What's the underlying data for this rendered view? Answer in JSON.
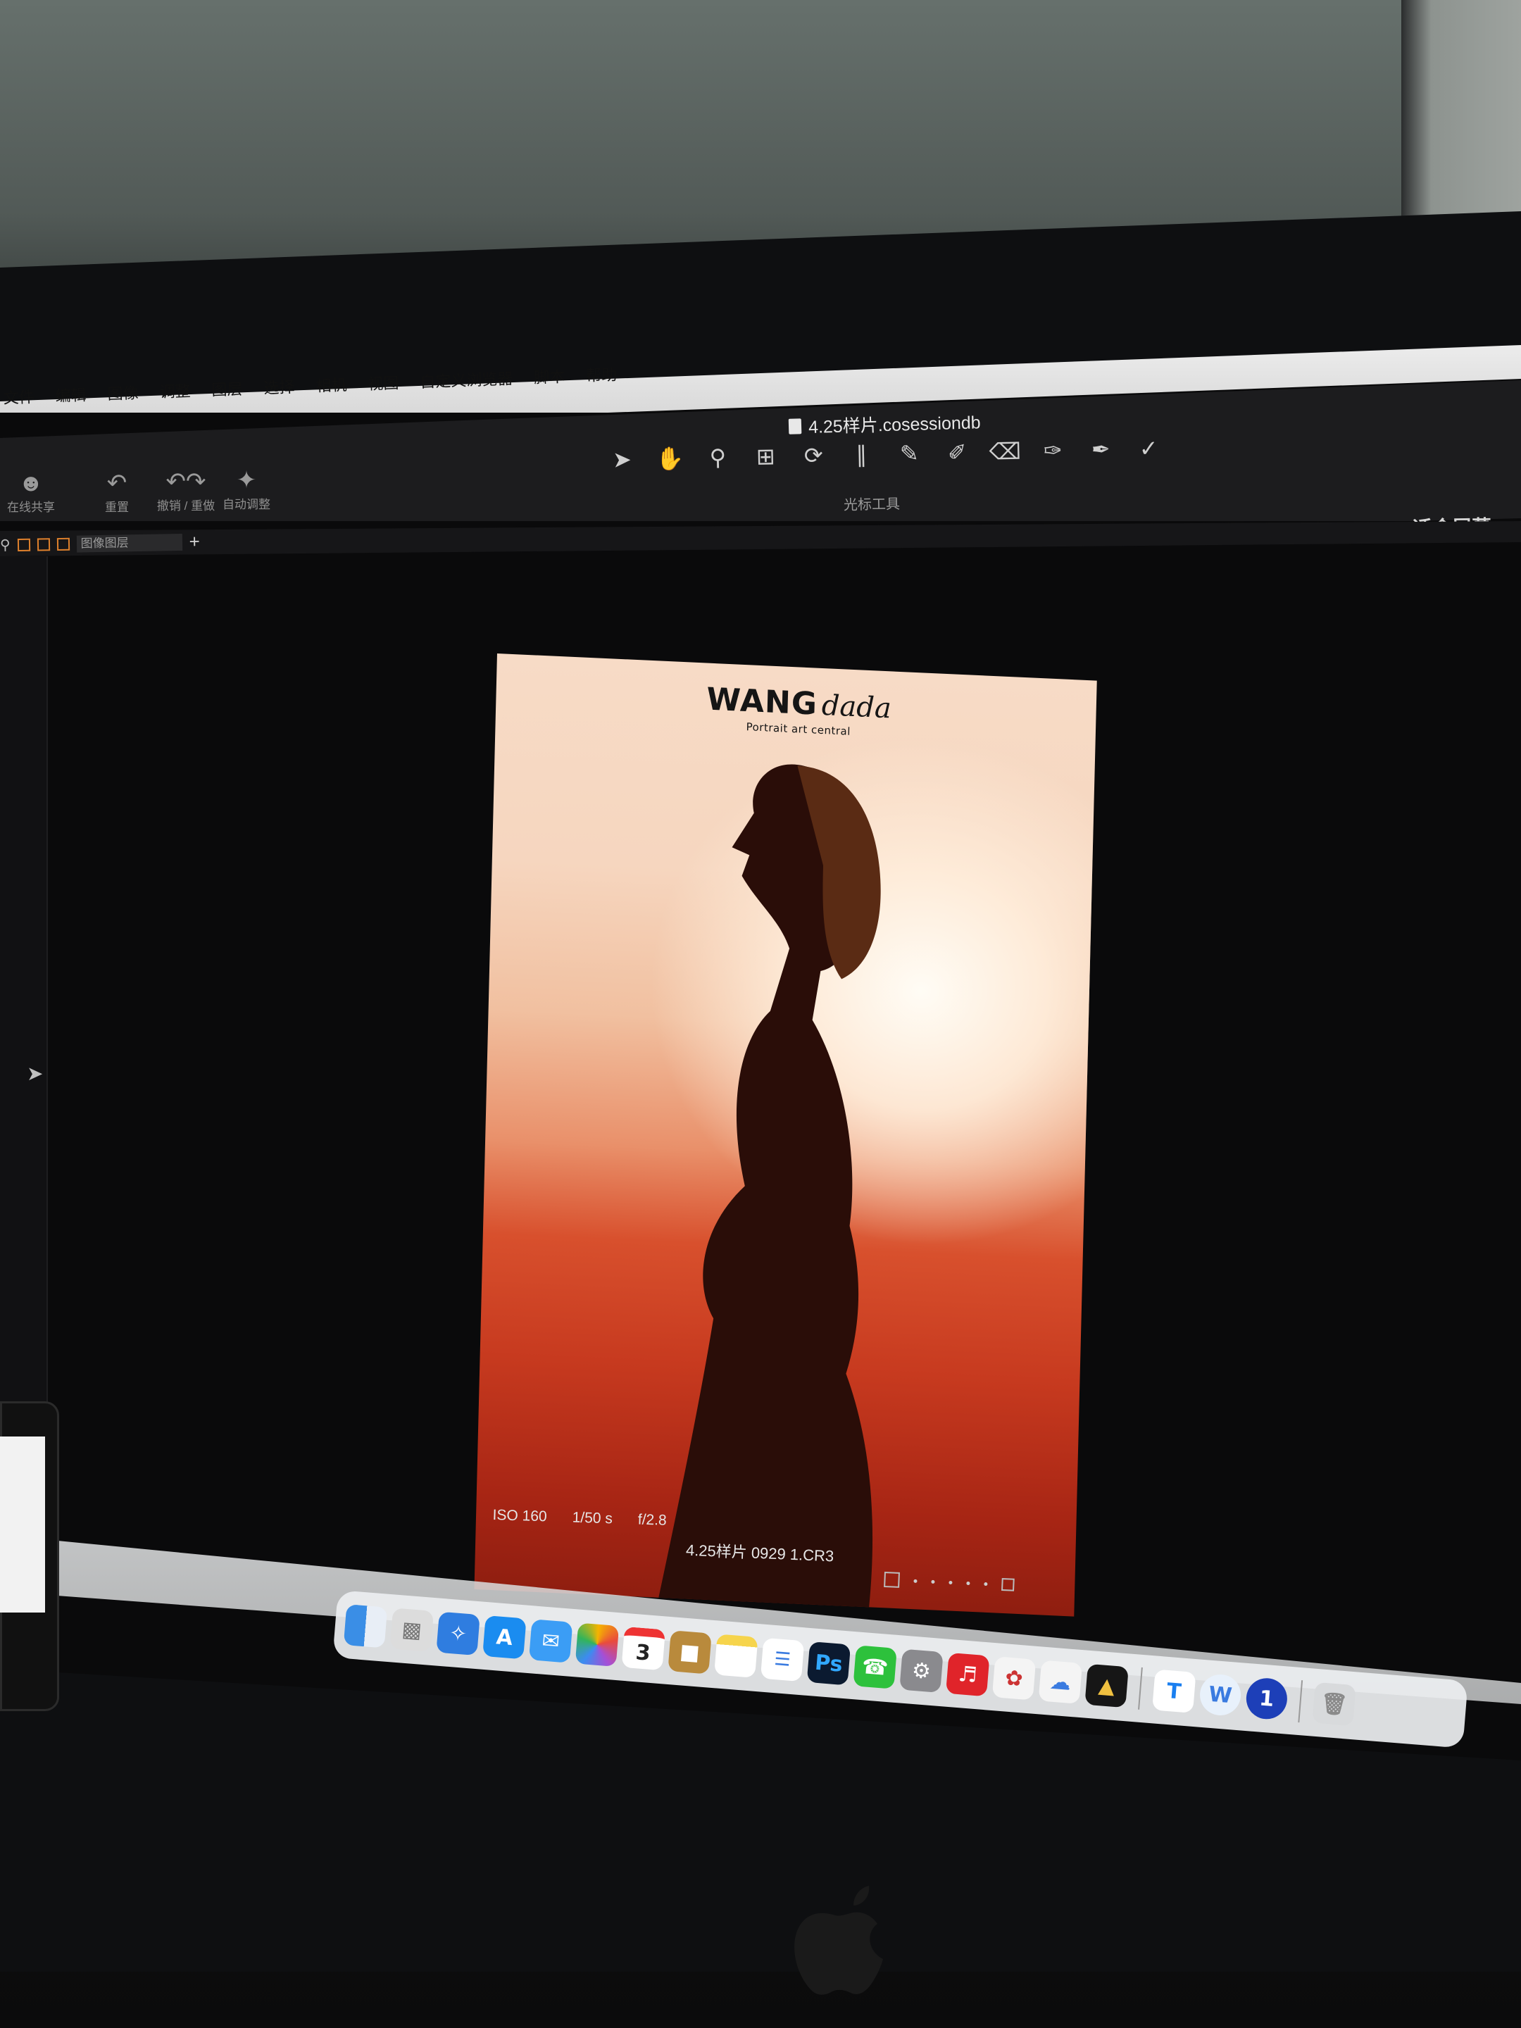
{
  "menubar": {
    "items": [
      "文件",
      "编辑",
      "图像",
      "调整",
      "图层",
      "选择",
      "相机",
      "视图",
      "自定义浏览器",
      "脚本",
      "帮助"
    ]
  },
  "window": {
    "title": "4.25样片.cosessiondb"
  },
  "toolbar_left": [
    {
      "icon": "people-icon",
      "label": "在线共享"
    },
    {
      "icon": "reset-icon",
      "label": "重置"
    },
    {
      "icon": "undo-redo-icon",
      "label": "撤销 / 重做"
    },
    {
      "icon": "magic-wand-icon",
      "label": "自动调整"
    }
  ],
  "cursor_tools": {
    "label": "光标工具",
    "tools": [
      "select-pointer-icon",
      "pan-hand-icon",
      "zoom-icon",
      "crop-icon",
      "rotate-icon",
      "keystone-icon",
      "color-picker-icon",
      "brush-icon",
      "eraser-icon",
      "gradient-mask-icon",
      "stroke-icon",
      "pen-icon"
    ]
  },
  "view": {
    "fit_label": "适合屏幕"
  },
  "layers": {
    "field_label": "图像图层",
    "add": "+"
  },
  "photo": {
    "brand_main": "WANG",
    "brand_script": "dada",
    "brand_sub": "Portrait art central"
  },
  "exif": {
    "iso": "ISO 160",
    "shutter": "1/50 s",
    "aperture": "f/2.8",
    "filename": "4.25样片 0929 1.CR3"
  },
  "dock": {
    "calendar_day": "3",
    "ps_label": "Ps",
    "apps": [
      "finder",
      "launchpad",
      "safari",
      "app-store",
      "mail",
      "photos",
      "calendar",
      "folder",
      "notes",
      "reminders",
      "photoshop",
      "wechat",
      "system-preferences",
      "netease-music",
      "app-15",
      "baidu-netdisk",
      "app-17",
      "app-18",
      "app-19",
      "onepassword",
      "trash"
    ]
  },
  "colors": {
    "accent": "#e79a3a",
    "photo_top": "#f7dbc6",
    "photo_bottom": "#8f1e10"
  }
}
